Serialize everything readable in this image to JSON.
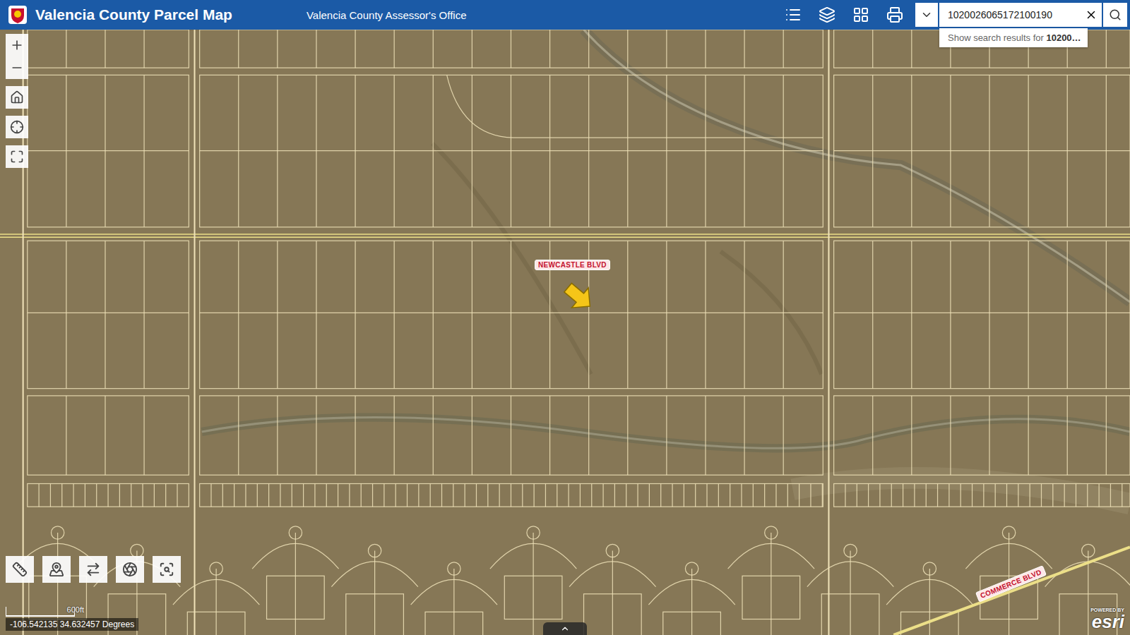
{
  "header": {
    "title": "Valencia County Parcel Map",
    "subtitle": "Valencia County Assessor's Office"
  },
  "search": {
    "value": "1020026065172100190",
    "suggestion_prefix": "Show search results for ",
    "suggestion_value": "10200…"
  },
  "map": {
    "road_labels": [
      "NEWCASTLE BLVD",
      "COMMERCE BLVD"
    ],
    "scale": "600ft",
    "coordinates": "-106.542135 34.632457 Degrees",
    "attribution_small": "POWERED BY",
    "attribution": "esri"
  }
}
